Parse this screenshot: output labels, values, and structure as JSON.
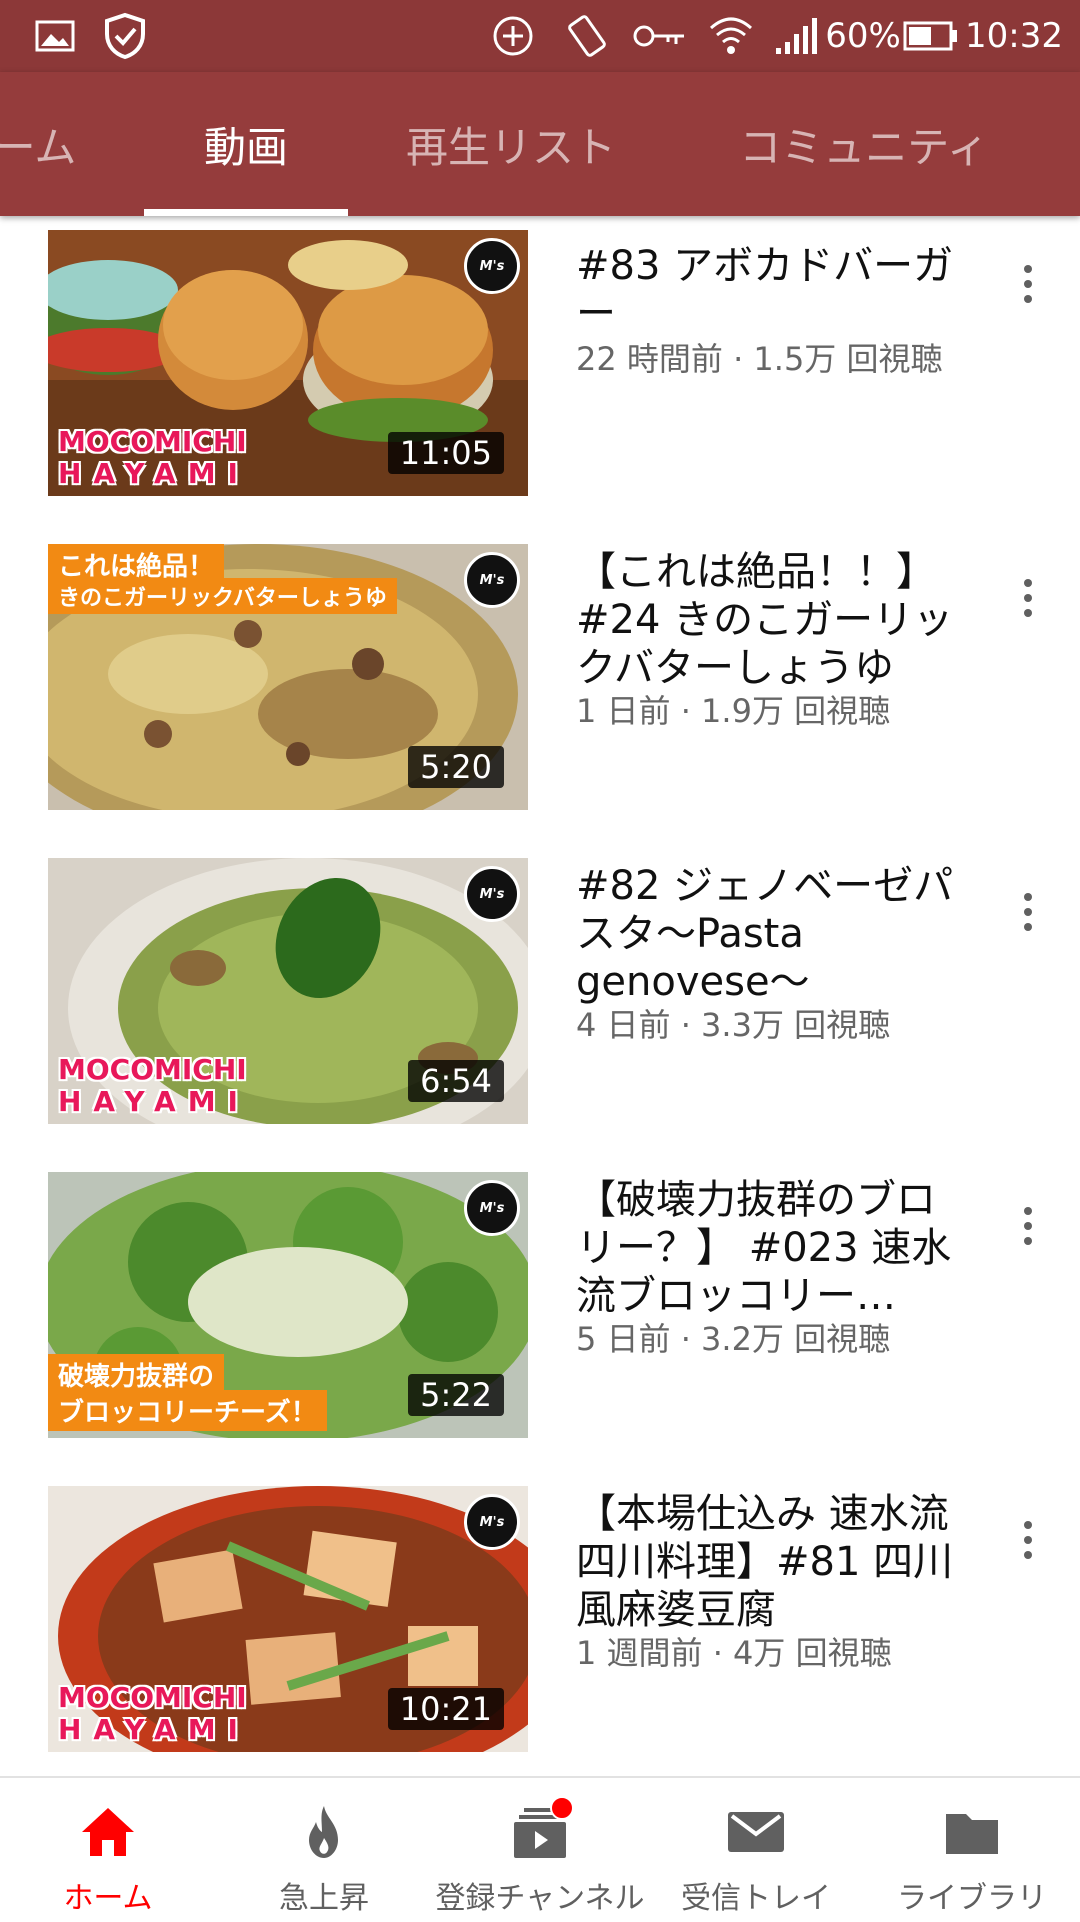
{
  "status_bar": {
    "battery": "60%",
    "time": "10:32",
    "icons": [
      "gallery-icon",
      "shield-check-icon",
      "add-circle-icon",
      "rotate-icon",
      "key-icon",
      "wifi-icon",
      "signal-icon",
      "battery-icon"
    ]
  },
  "tabs": [
    {
      "label": "ーム"
    },
    {
      "label": "動画",
      "active": true
    },
    {
      "label": "再生リスト"
    },
    {
      "label": "コミュニティ"
    }
  ],
  "videos": [
    {
      "title": "#83 アボカドバーガー",
      "meta": "22 時間前 · 1.5万 回視聴",
      "duration": "11:05",
      "overlay": {
        "brand": [
          "MOCOMICHI",
          "HAYAMI"
        ],
        "logo": "M's"
      }
    },
    {
      "title": "【これは絶品！！】#24 きのこガーリックバターしょうゆ",
      "meta": "1 日前 · 1.9万 回視聴",
      "duration": "5:20",
      "overlay": {
        "banner": [
          "これは絶品！",
          "きのこガーリックバターしょうゆ"
        ],
        "logo": "M's"
      }
    },
    {
      "title": "#82 ジェノベーゼパスタ〜Pasta genovese〜",
      "meta": "4 日前 · 3.3万 回視聴",
      "duration": "6:54",
      "overlay": {
        "brand": [
          "MOCOMICHI",
          "HAYAMI"
        ],
        "logo": "M's"
      }
    },
    {
      "title": "【破壊力抜群のブロリー？】 #023 速水流ブロッコリー…",
      "meta": "5 日前 · 3.2万 回視聴",
      "duration": "5:22",
      "overlay": {
        "banner": [
          "破壊力抜群の",
          "ブロッコリーチーズ！"
        ],
        "logo": "M's"
      }
    },
    {
      "title": "【本場仕込み 速水流四川料理】#81 四川風麻婆豆腐",
      "meta": "1 週間前 · 4万 回視聴",
      "duration": "10:21",
      "overlay": {
        "brand": [
          "MOCOMICHI",
          "HAYAMI"
        ],
        "logo": "M's"
      }
    }
  ],
  "bottom_nav": [
    {
      "label": "ホーム",
      "icon": "home-icon",
      "active": true
    },
    {
      "label": "急上昇",
      "icon": "flame-icon"
    },
    {
      "label": "登録チャンネル",
      "icon": "subscriptions-icon",
      "badge": true
    },
    {
      "label": "受信トレイ",
      "icon": "mail-icon"
    },
    {
      "label": "ライブラリ",
      "icon": "folder-icon"
    }
  ],
  "colors": {
    "header": "#953c3c",
    "status_bar": "#8c3838",
    "accent": "#ff0000"
  }
}
